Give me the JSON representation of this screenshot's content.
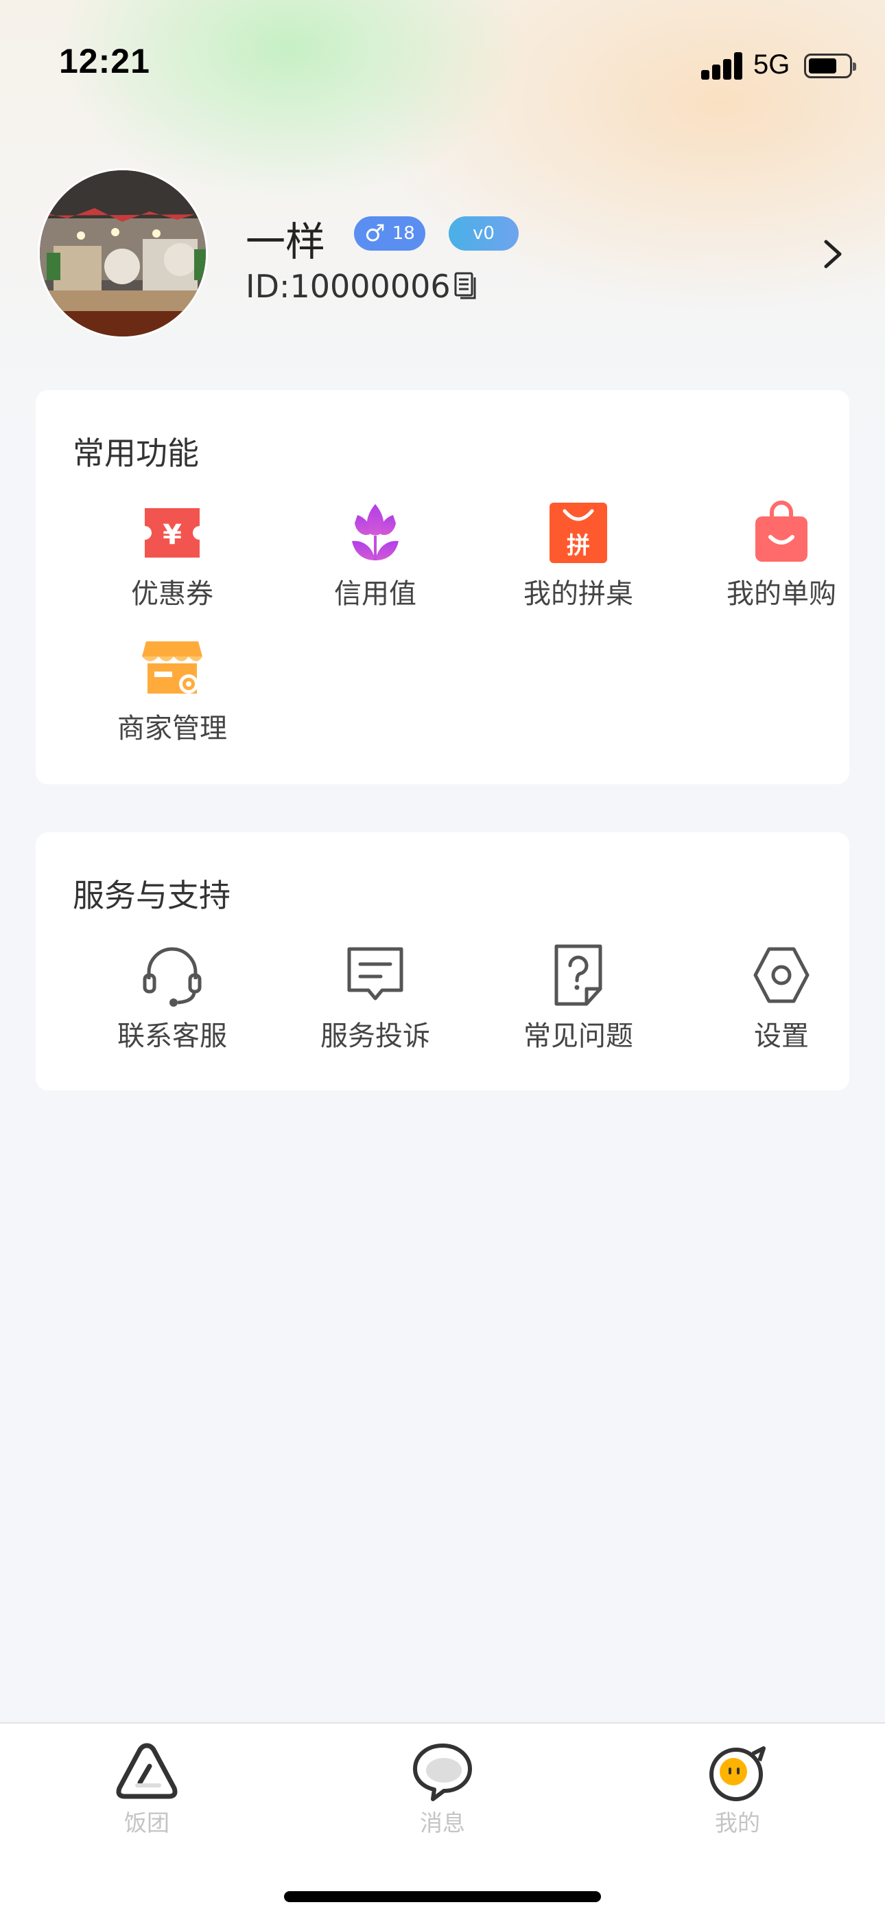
{
  "status_bar": {
    "time": "12:21",
    "network": "5G",
    "battery_level": 0.72
  },
  "profile": {
    "nickname": "一样",
    "gender_symbol": "♂",
    "age": "18",
    "level": "v0",
    "user_id": "ID:10000006"
  },
  "common_functions": {
    "title": "常用功能",
    "items": [
      {
        "label": "优惠券",
        "icon": "coupon-icon",
        "color": "#f2554f"
      },
      {
        "label": "信用值",
        "icon": "tulip-icon",
        "color": "#b84fe0"
      },
      {
        "label": "我的拼桌",
        "icon": "group-table-bag-icon",
        "color": "#ff5a2e"
      },
      {
        "label": "我的单购",
        "icon": "shopping-bag-icon",
        "color": "#ff6b6b"
      },
      {
        "label": "商家管理",
        "icon": "store-icon",
        "color": "#ffab3c"
      }
    ]
  },
  "service_support": {
    "title": "服务与支持",
    "items": [
      {
        "label": "联系客服",
        "icon": "headset-icon"
      },
      {
        "label": "服务投诉",
        "icon": "message-complaint-icon"
      },
      {
        "label": "常见问题",
        "icon": "question-doc-icon"
      },
      {
        "label": "设置",
        "icon": "settings-hexagon-icon"
      }
    ]
  },
  "tab_bar": {
    "tabs": [
      {
        "label": "饭团",
        "icon": "rice-ball-icon"
      },
      {
        "label": "消息",
        "icon": "chat-bubble-icon"
      },
      {
        "label": "我的",
        "icon": "profile-face-icon",
        "active": true
      }
    ]
  }
}
